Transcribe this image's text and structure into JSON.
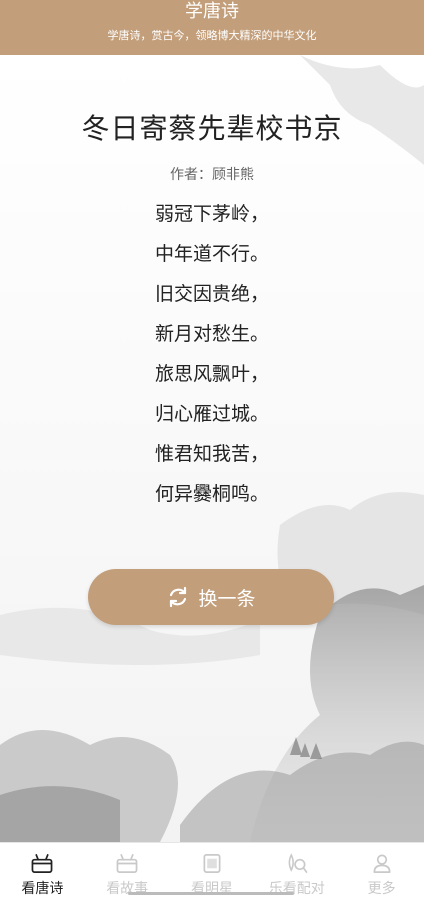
{
  "header": {
    "title": "学唐诗",
    "subtitle": "学唐诗，赏古今，领略博大精深的中华文化"
  },
  "poem": {
    "title": "冬日寄蔡先辈校书京",
    "author": "作者：顾非熊",
    "lines": [
      "弱冠下茅岭，",
      "中年道不行。",
      "旧交因贵绝，",
      "新月对愁生。",
      "旅思风飘叶，",
      "归心雁过城。",
      "惟君知我苦，",
      "何异爨桐鸣。"
    ]
  },
  "refresh_button": {
    "label": "换一条",
    "icon": "refresh-icon"
  },
  "tabs": [
    {
      "label": "看唐诗",
      "icon": "gift-icon",
      "active": true
    },
    {
      "label": "看故事",
      "icon": "gift-icon",
      "active": false
    },
    {
      "label": "看明星",
      "icon": "film-icon",
      "active": false
    },
    {
      "label": "乐看配对",
      "icon": "magnify-icon",
      "active": false
    },
    {
      "label": "更多",
      "icon": "user-icon",
      "active": false
    }
  ],
  "colors": {
    "accent": "#c29e7a",
    "text": "#222222",
    "inactive": "#c9c9c9"
  }
}
